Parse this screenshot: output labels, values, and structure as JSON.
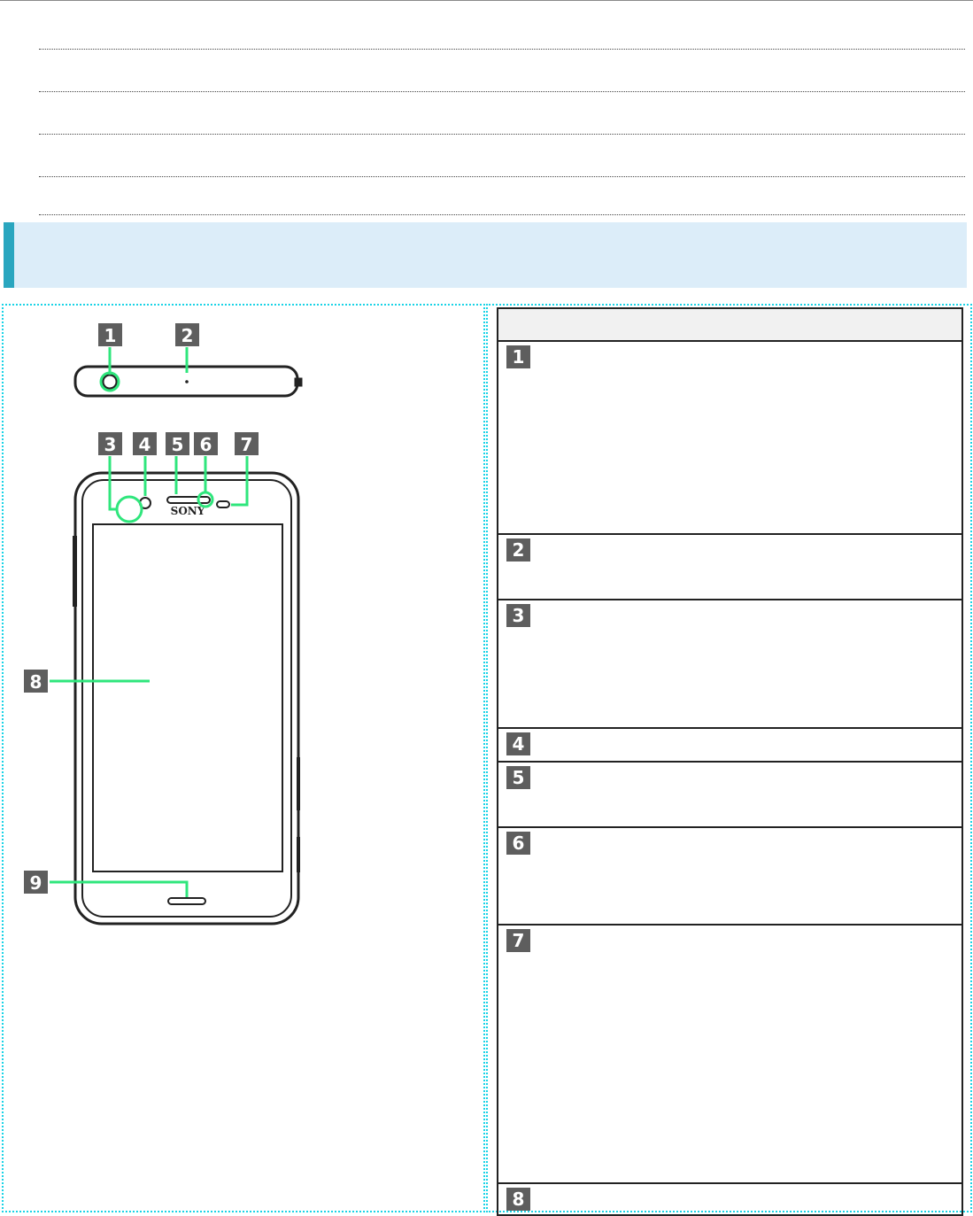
{
  "callout_color": "#2fe67c",
  "heading_bar_color": "#2aa6bf",
  "heading_bg_color": "#dcedf9",
  "phone": {
    "brand": "SONY",
    "callouts": [
      "1",
      "2",
      "3",
      "4",
      "5",
      "6",
      "7",
      "8",
      "9"
    ]
  },
  "parts_table": {
    "rows": [
      {
        "num": "1"
      },
      {
        "num": "2"
      },
      {
        "num": "3"
      },
      {
        "num": "4"
      },
      {
        "num": "5"
      },
      {
        "num": "6"
      },
      {
        "num": "7"
      },
      {
        "num": "8"
      }
    ]
  }
}
